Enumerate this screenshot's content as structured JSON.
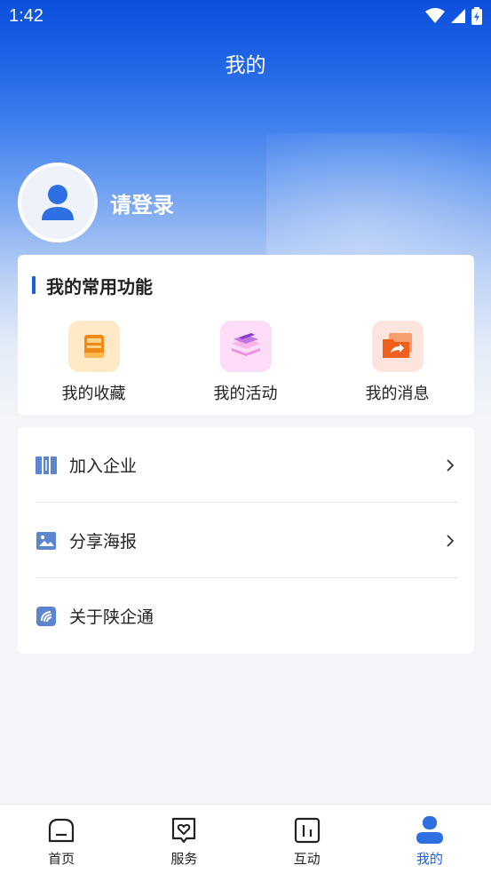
{
  "status_bar": {
    "time": "1:42"
  },
  "header": {
    "title": "我的"
  },
  "profile": {
    "login_text": "请登录"
  },
  "functions": {
    "title": "我的常用功能",
    "items": [
      {
        "label": "我的收藏",
        "icon": "collection-book-icon",
        "bg": "#ffe9c6"
      },
      {
        "label": "我的活动",
        "icon": "activity-layers-icon",
        "bg": "#fcdcf6"
      },
      {
        "label": "我的消息",
        "icon": "message-folder-icon",
        "bg": "#fde5dd"
      }
    ]
  },
  "menu": {
    "items": [
      {
        "label": "加入企业",
        "icon": "enterprise-book-icon",
        "has_arrow": true
      },
      {
        "label": "分享海报",
        "icon": "poster-image-icon",
        "has_arrow": true
      },
      {
        "label": "关于陕企通",
        "icon": "app-logo-icon",
        "has_arrow": false
      }
    ]
  },
  "tabbar": {
    "items": [
      {
        "label": "首页",
        "icon": "home-icon",
        "active": false
      },
      {
        "label": "服务",
        "icon": "service-heart-icon",
        "active": false
      },
      {
        "label": "互动",
        "icon": "interact-chart-icon",
        "active": false
      },
      {
        "label": "我的",
        "icon": "profile-person-icon",
        "active": true
      }
    ]
  },
  "colors": {
    "accent": "#1a5fe0",
    "hero_top": "#0b4fdc"
  }
}
